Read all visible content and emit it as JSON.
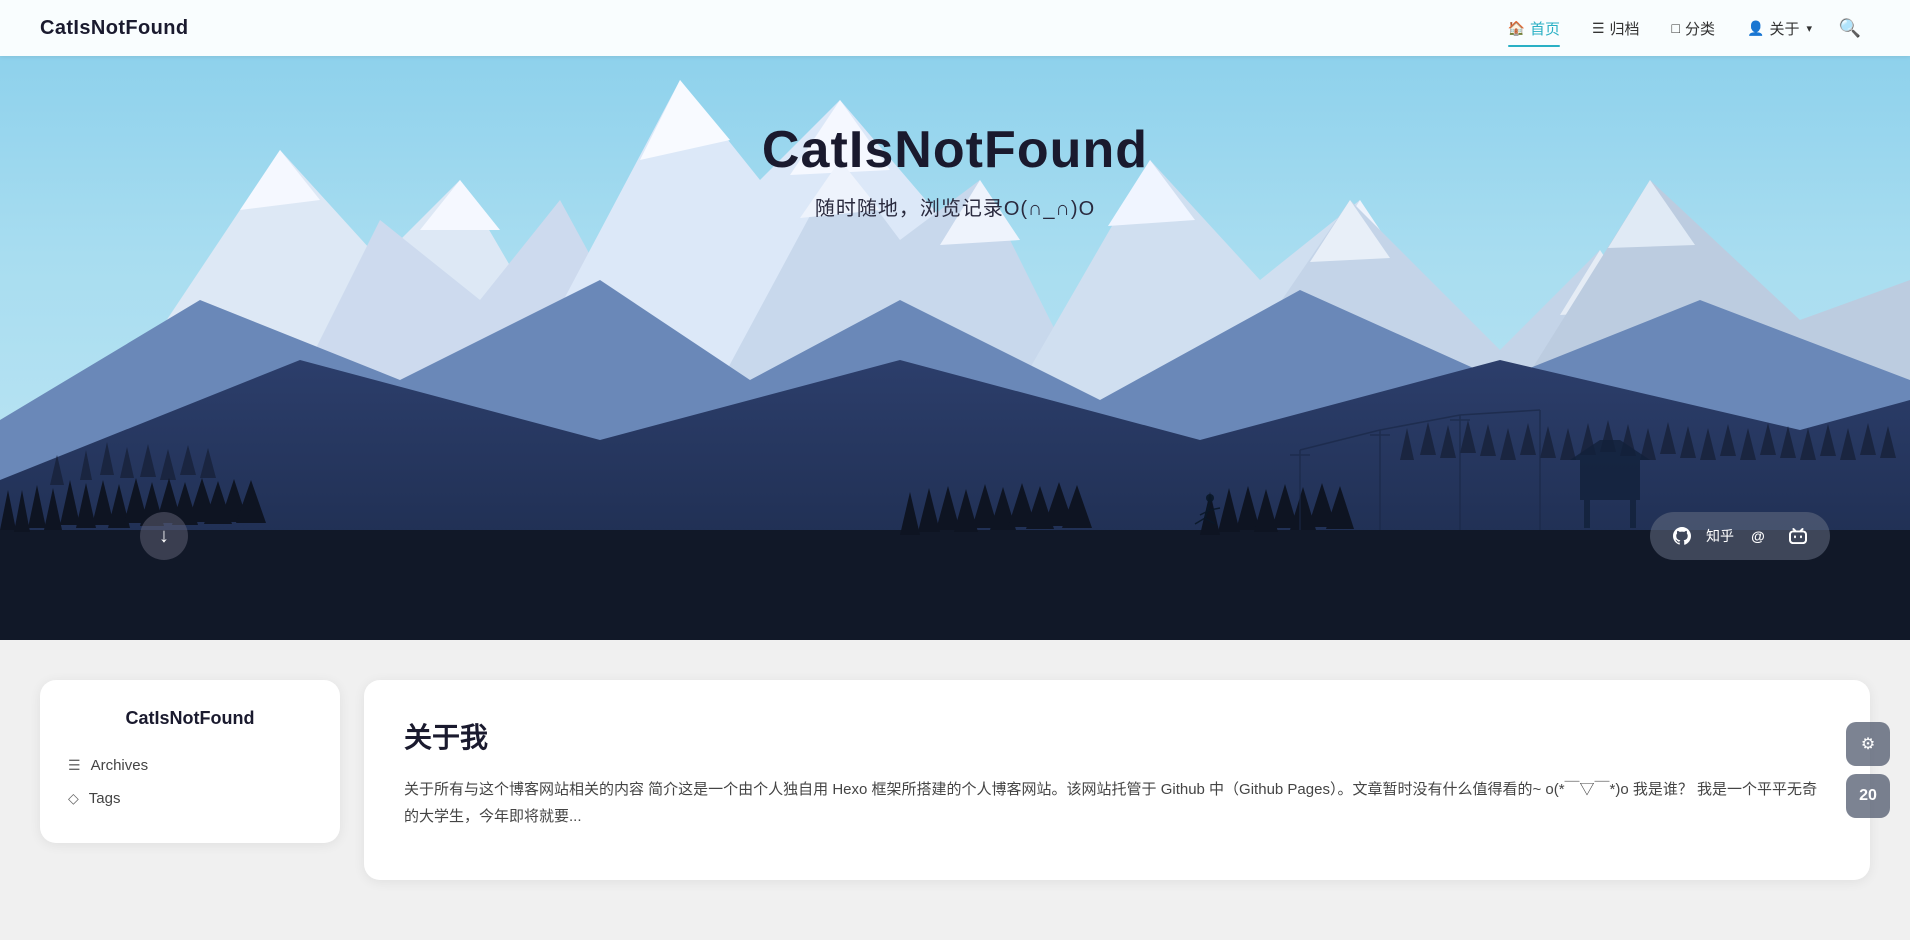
{
  "navbar": {
    "logo": "CatIsNotFound",
    "links": [
      {
        "label": "首页",
        "icon": "🏠",
        "active": true,
        "id": "home"
      },
      {
        "label": "归档",
        "icon": "☰",
        "active": false,
        "id": "archives"
      },
      {
        "label": "分类",
        "icon": "□",
        "active": false,
        "id": "categories"
      },
      {
        "label": "关于",
        "icon": "👤",
        "active": false,
        "has_dropdown": true,
        "id": "about"
      }
    ],
    "search_label": "🔍"
  },
  "hero": {
    "title": "CatIsNotFound",
    "subtitle": "随时随地，浏览记录O(∩_∩)O",
    "scroll_down_icon": "↓",
    "social_links": [
      {
        "label": "github",
        "icon": "⊙",
        "id": "github"
      },
      {
        "label": "知乎",
        "text": "知乎",
        "id": "zhihu"
      },
      {
        "label": "email",
        "icon": "@",
        "id": "email"
      },
      {
        "label": "bilibili",
        "icon": "📺",
        "id": "bilibili"
      }
    ]
  },
  "sidebar": {
    "site_name": "CatIsNotFound",
    "links": [
      {
        "label": "Archives",
        "icon": "☰",
        "id": "archives"
      },
      {
        "label": "Tags",
        "icon": "◇",
        "id": "tags"
      }
    ]
  },
  "about": {
    "title": "关于我",
    "body": "关于所有与这个博客网站相关的内容 简介这是一个由个人独自用 Hexo 框架所搭建的个人博客网站。该网站托管于 Github 中（Github Pages）。文章暂时没有什么值得看的~ o(*￣▽￣*)o 我是谁？ 我是一个平平无奇的大学生，今年即将就要..."
  },
  "fab": {
    "settings_icon": "⚙",
    "count": "20"
  }
}
